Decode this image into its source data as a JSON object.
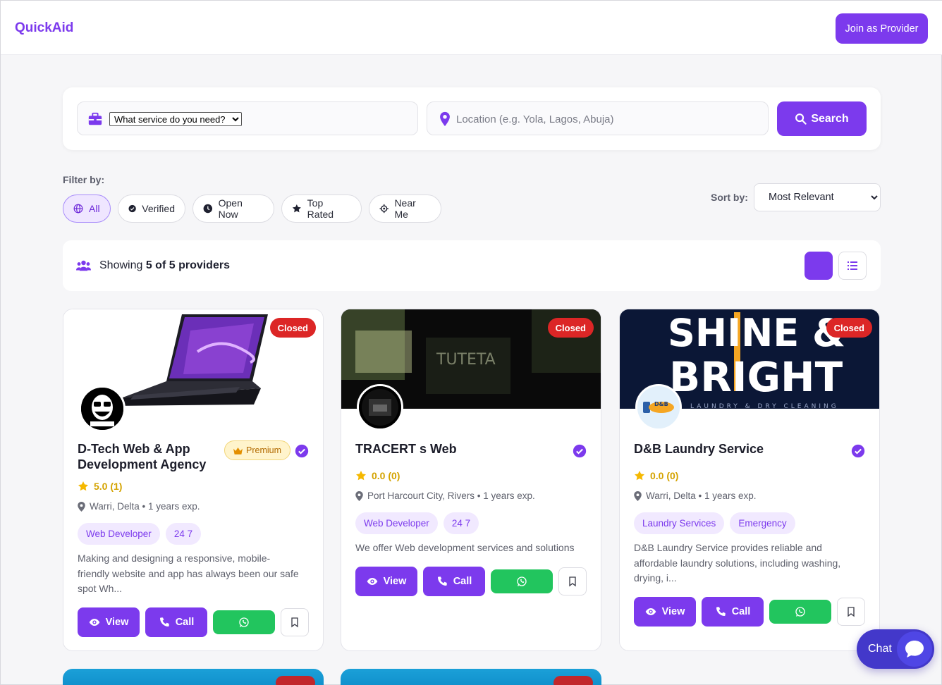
{
  "header": {
    "brand": "QuickAid",
    "join_label": "Join as Provider"
  },
  "search": {
    "service_selected": "What service do you need?",
    "location_placeholder": "Location (e.g. Yola, Lagos, Abuja)",
    "button_label": "Search"
  },
  "filters": {
    "label": "Filter by:",
    "chips": [
      {
        "label": "All",
        "icon": "globe-icon",
        "active": true
      },
      {
        "label": "Verified",
        "icon": "check-circle-icon",
        "active": false
      },
      {
        "label": "Open Now",
        "icon": "clock-icon",
        "active": false
      },
      {
        "label": "Top Rated",
        "icon": "star-icon",
        "active": false
      },
      {
        "label": "Near Me",
        "icon": "crosshair-icon",
        "active": false
      }
    ],
    "sort_label": "Sort by:",
    "sort_selected": "Most Relevant"
  },
  "results": {
    "prefix": "Showing",
    "count": "5 of 5 providers"
  },
  "cards": [
    {
      "status": "Closed",
      "title_line1": "D-Tech Web & App",
      "title_line2": "Development Agency",
      "premium": "Premium",
      "rating": "5.0 (1)",
      "location": "Warri, Delta • 1 years exp.",
      "tags": [
        "Web Developer",
        "24 7"
      ],
      "desc_line1": "Making and designing a responsive, mobile-",
      "desc_line2": "friendly website and app has always been our safe",
      "desc_line3": "spot Wh...",
      "view_label": "View",
      "call_label": "Call"
    },
    {
      "status": "Closed",
      "title_line1": "TRACERT s Web",
      "cover_text": "TUTETA",
      "rating": "0.0 (0)",
      "location": "Port Harcourt City, Rivers • 1 years exp.",
      "tags": [
        "Web Developer",
        "24 7"
      ],
      "desc_line1": "We offer Web development services and solutions",
      "view_label": "View",
      "call_label": "Call"
    },
    {
      "status": "Closed",
      "title_line1": "D&B Laundry Service",
      "cover_text_line1": "SHINE &",
      "cover_text_line2": "BRIGHT",
      "cover_text_line3": "LAUNDRY & DRY CLEANING",
      "avatar_text": "D&B",
      "rating": "0.0 (0)",
      "location": "Warri, Delta • 1 years exp.",
      "tags": [
        "Laundry Services",
        "Emergency"
      ],
      "desc_line1": "D&B Laundry Service provides reliable and",
      "desc_line2": "affordable laundry solutions, including washing,",
      "desc_line3": "drying, i...",
      "view_label": "View",
      "call_label": "Call"
    }
  ],
  "chat": {
    "label": "Chat"
  },
  "colors": {
    "accent": "#7c3aed",
    "closed": "#dc2626",
    "whatsapp": "#22c55e",
    "chat": "#4338ca"
  }
}
